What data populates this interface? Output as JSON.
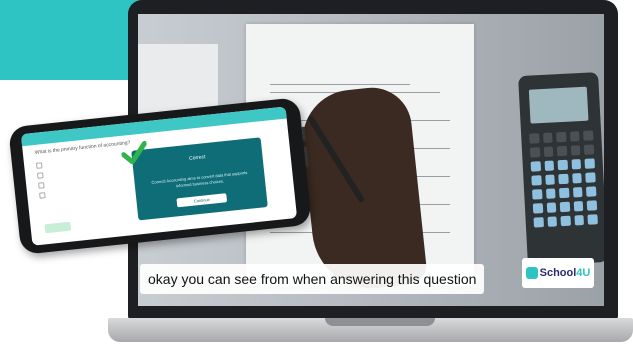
{
  "video": {
    "caption": "okay you can see from when answering this question",
    "logo_text": "School",
    "logo_accent": "4U"
  },
  "phone": {
    "tabs": [
      "",
      "",
      ""
    ],
    "question": "What is the primary function of accounting?",
    "options": [
      "",
      "",
      "",
      ""
    ],
    "modal": {
      "title": "Correct",
      "text": "Correct! Accounting aims to convert data that supports informed business choices.",
      "button": "Continue"
    }
  },
  "colors": {
    "teal": "#2ec4c3",
    "modal": "#0f6d78",
    "check": "#2fb34a"
  }
}
